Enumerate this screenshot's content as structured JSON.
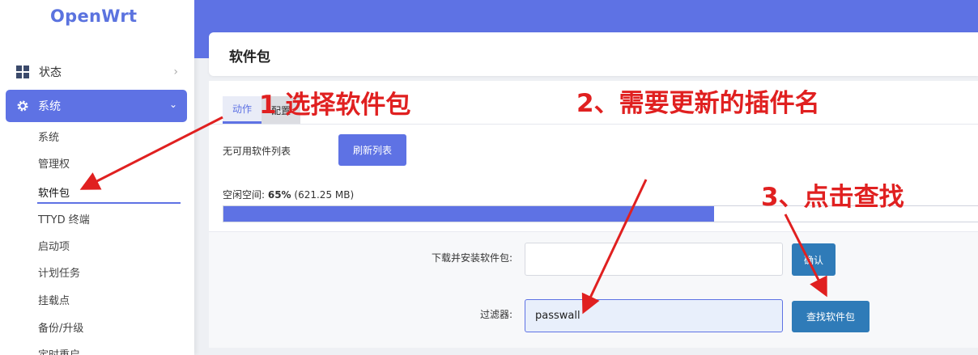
{
  "sidebar": {
    "logo": "OpenWrt",
    "menu": [
      {
        "label": "状态",
        "icon": "dashboard-icon",
        "expanded": false
      },
      {
        "label": "系统",
        "icon": "gear-icon",
        "expanded": true
      }
    ],
    "submenu": [
      "系统",
      "管理权",
      "软件包",
      "TTYD 终端",
      "启动项",
      "计划任务",
      "挂载点",
      "备份/升级",
      "定时重启"
    ],
    "active_submenu": "软件包"
  },
  "page": {
    "title": "软件包",
    "tabs": [
      {
        "label": "动作",
        "active": true
      },
      {
        "label": "配置",
        "active": false
      }
    ],
    "no_list_text": "无可用软件列表",
    "refresh_button": "刷新列表",
    "free_space": {
      "label": "空闲空间: ",
      "percent_text": "65%",
      "detail": " (621.25 MB)",
      "fraction_free": 0.65
    },
    "download_install_label": "下载并安装软件包:",
    "download_input_value": "",
    "confirm_button": "确认",
    "filter_label": "过滤器:",
    "filter_value": "passwall",
    "find_button": "查找软件包"
  },
  "annotations": {
    "step1": "1 选择软件包",
    "step2": "2、需要更新的插件名",
    "step3": "3、点击查找"
  },
  "colors": {
    "accent": "#5e72e4",
    "find_button": "#2f7bb8",
    "annotation": "#e02020"
  }
}
